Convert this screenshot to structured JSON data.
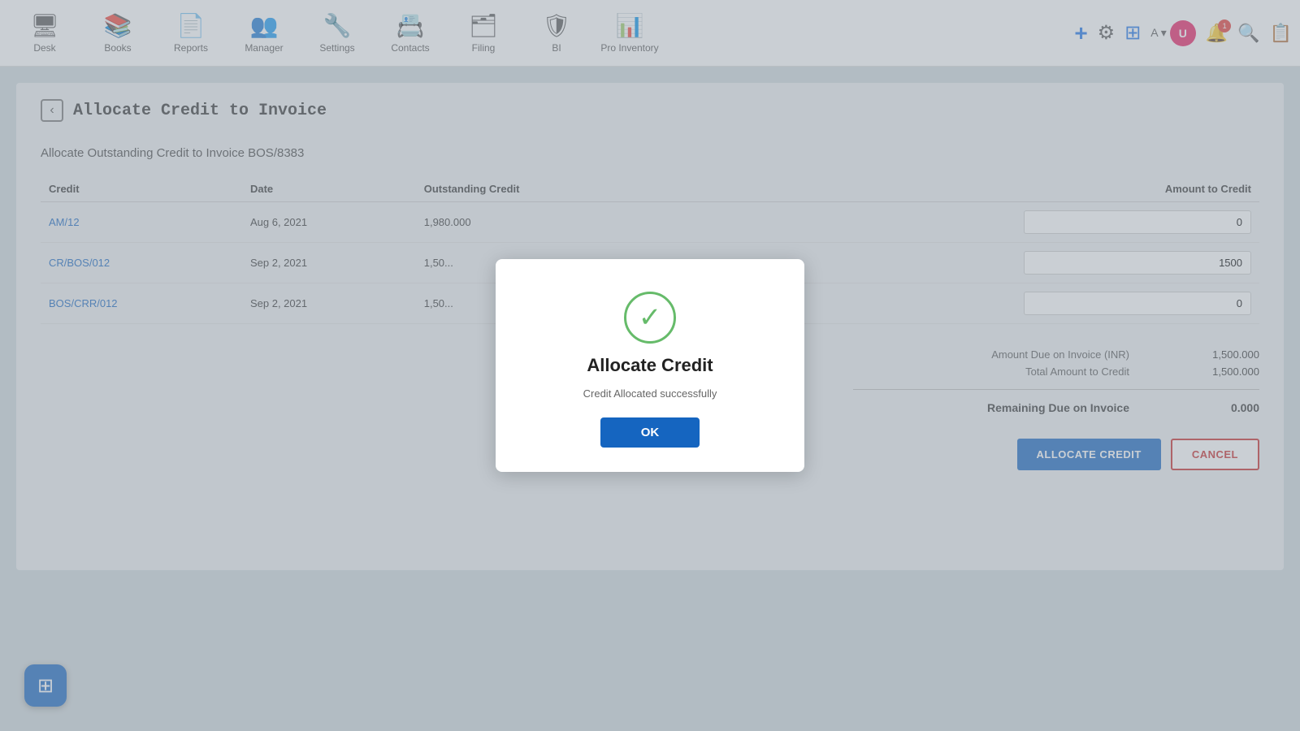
{
  "nav": {
    "items": [
      {
        "id": "desk",
        "label": "Desk",
        "icon": "🖥"
      },
      {
        "id": "books",
        "label": "Books",
        "icon": "📚"
      },
      {
        "id": "reports",
        "label": "Reports",
        "icon": "📄"
      },
      {
        "id": "manager",
        "label": "Manager",
        "icon": "👥"
      },
      {
        "id": "settings",
        "label": "Settings",
        "icon": "🔧"
      },
      {
        "id": "contacts",
        "label": "Contacts",
        "icon": "📇"
      },
      {
        "id": "filing",
        "label": "Filing",
        "icon": "🗂"
      },
      {
        "id": "bi",
        "label": "BI",
        "icon": "🛡"
      },
      {
        "id": "pro_inventory",
        "label": "Pro Inventory",
        "icon": "📊"
      }
    ]
  },
  "page": {
    "title": "Allocate Credit to Invoice",
    "subtitle": "Allocate Outstanding Credit to Invoice BOS/8383"
  },
  "table": {
    "headers": [
      "Credit",
      "Date",
      "Outstanding Credit",
      "Amount to Credit"
    ],
    "rows": [
      {
        "credit": "AM/12",
        "date": "Aug 6, 2021",
        "outstanding": "1,980.000",
        "amount": "0"
      },
      {
        "credit": "CR/BOS/012",
        "date": "Sep 2, 2021",
        "outstanding": "1,50...",
        "amount": "1500"
      },
      {
        "credit": "BOS/CRR/012",
        "date": "Sep 2, 2021",
        "outstanding": "1,50...",
        "amount": "0"
      }
    ]
  },
  "summary": {
    "amount_due_label": "Amount Due on Invoice (INR)",
    "amount_due_value": "1,500.000",
    "total_amount_label": "Total Amount to Credit",
    "total_amount_value": "1,500.000",
    "remaining_label": "Remaining Due on Invoice",
    "remaining_value": "0.000"
  },
  "buttons": {
    "allocate": "ALLOCATE CREDIT",
    "cancel": "CANCEL"
  },
  "dialog": {
    "title": "Allocate Credit",
    "subtitle": "Credit Allocated successfully",
    "ok_label": "OK"
  },
  "fab": {
    "icon": "⊞"
  }
}
